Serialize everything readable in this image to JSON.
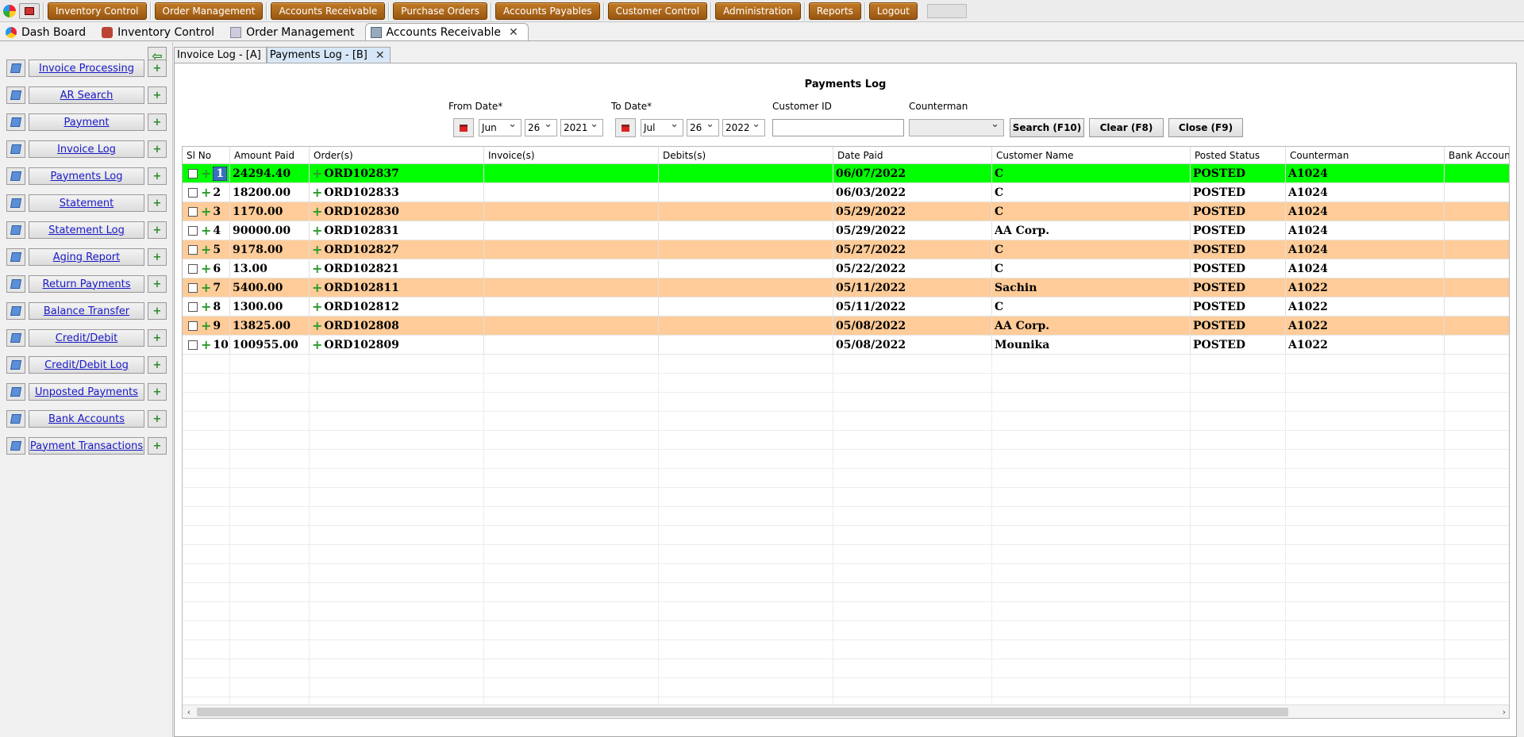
{
  "toolbar": {
    "modules": [
      "Inventory Control",
      "Order Management",
      "Accounts Receivable",
      "Purchase Orders",
      "Accounts Payables",
      "Customer Control",
      "Administration",
      "Reports",
      "Logout"
    ]
  },
  "module_tabs": [
    {
      "label": "Dash Board",
      "icon": "dashboard-icon"
    },
    {
      "label": "Inventory Control",
      "icon": "inventory-icon"
    },
    {
      "label": "Order Management",
      "icon": "order-icon"
    },
    {
      "label": "Accounts Receivable",
      "icon": "receivable-icon",
      "active": true
    }
  ],
  "sidebar": {
    "items": [
      "Invoice Processing",
      "AR Search",
      "Payment",
      "Invoice Log",
      "Payments Log",
      "Statement",
      "Statement Log",
      "Aging Report",
      "Return Payments",
      "Balance Transfer",
      "Credit/Debit",
      "Credit/Debit Log",
      "Unposted Payments",
      "Bank Accounts",
      "Payment Transactions"
    ]
  },
  "sub_tabs": [
    {
      "label": "Invoice Log - [A]"
    },
    {
      "label": "Payments Log - [B]",
      "active": true
    }
  ],
  "panel": {
    "title": "Payments Log"
  },
  "filters": {
    "from_date_label": "From Date*",
    "to_date_label": "To Date*",
    "customer_id_label": "Customer ID",
    "counterman_label": "Counterman",
    "from_month": "Jun",
    "from_day": "26",
    "from_year": "2021",
    "to_month": "Jul",
    "to_day": "26",
    "to_year": "2022",
    "customer_id_value": "",
    "counterman_value": "",
    "search_label": "Search (F10)",
    "clear_label": "Clear (F8)",
    "close_label": "Close (F9)"
  },
  "table": {
    "columns": [
      "Sl No",
      "Amount Paid",
      "Order(s)",
      "Invoice(s)",
      "Debits(s)",
      "Date Paid",
      "Customer Name",
      "Posted Status",
      "Counterman",
      "Bank Account"
    ],
    "rows": [
      {
        "sl": "1",
        "amount": "24294.40",
        "order": "ORD102837",
        "invoice": "",
        "debits": "",
        "date": "06/07/2022",
        "customer": "C",
        "status": "POSTED",
        "counterman": "A1024",
        "bank": "",
        "style": "selected"
      },
      {
        "sl": "2",
        "amount": "18200.00",
        "order": "ORD102833",
        "invoice": "",
        "debits": "",
        "date": "06/03/2022",
        "customer": "C",
        "status": "POSTED",
        "counterman": "A1024",
        "bank": "",
        "style": "plain"
      },
      {
        "sl": "3",
        "amount": "1170.00",
        "order": "ORD102830",
        "invoice": "",
        "debits": "",
        "date": "05/29/2022",
        "customer": "C",
        "status": "POSTED",
        "counterman": "A1024",
        "bank": "",
        "style": "alt"
      },
      {
        "sl": "4",
        "amount": "90000.00",
        "order": "ORD102831",
        "invoice": "",
        "debits": "",
        "date": "05/29/2022",
        "customer": "AA Corp.",
        "status": "POSTED",
        "counterman": "A1024",
        "bank": "",
        "style": "plain"
      },
      {
        "sl": "5",
        "amount": "9178.00",
        "order": "ORD102827",
        "invoice": "",
        "debits": "",
        "date": "05/27/2022",
        "customer": "C",
        "status": "POSTED",
        "counterman": "A1024",
        "bank": "",
        "style": "alt"
      },
      {
        "sl": "6",
        "amount": "13.00",
        "order": "ORD102821",
        "invoice": "",
        "debits": "",
        "date": "05/22/2022",
        "customer": "C",
        "status": "POSTED",
        "counterman": "A1024",
        "bank": "",
        "style": "plain"
      },
      {
        "sl": "7",
        "amount": "5400.00",
        "order": "ORD102811",
        "invoice": "",
        "debits": "",
        "date": "05/11/2022",
        "customer": "Sachin",
        "status": "POSTED",
        "counterman": "A1022",
        "bank": "",
        "style": "alt"
      },
      {
        "sl": "8",
        "amount": "1300.00",
        "order": "ORD102812",
        "invoice": "",
        "debits": "",
        "date": "05/11/2022",
        "customer": "C",
        "status": "POSTED",
        "counterman": "A1022",
        "bank": "",
        "style": "plain"
      },
      {
        "sl": "9",
        "amount": "13825.00",
        "order": "ORD102808",
        "invoice": "",
        "debits": "",
        "date": "05/08/2022",
        "customer": "AA Corp.",
        "status": "POSTED",
        "counterman": "A1022",
        "bank": "",
        "style": "alt"
      },
      {
        "sl": "10",
        "amount": "100955.00",
        "order": "ORD102809",
        "invoice": "",
        "debits": "",
        "date": "05/08/2022",
        "customer": "Mounika",
        "status": "POSTED",
        "counterman": "A1022",
        "bank": "",
        "style": "plain"
      }
    ]
  },
  "colors": {
    "selected_row": "#00ff00",
    "alt_row": "#ffcc99",
    "module_button": "#a8621a",
    "link": "#1a1ac8"
  }
}
